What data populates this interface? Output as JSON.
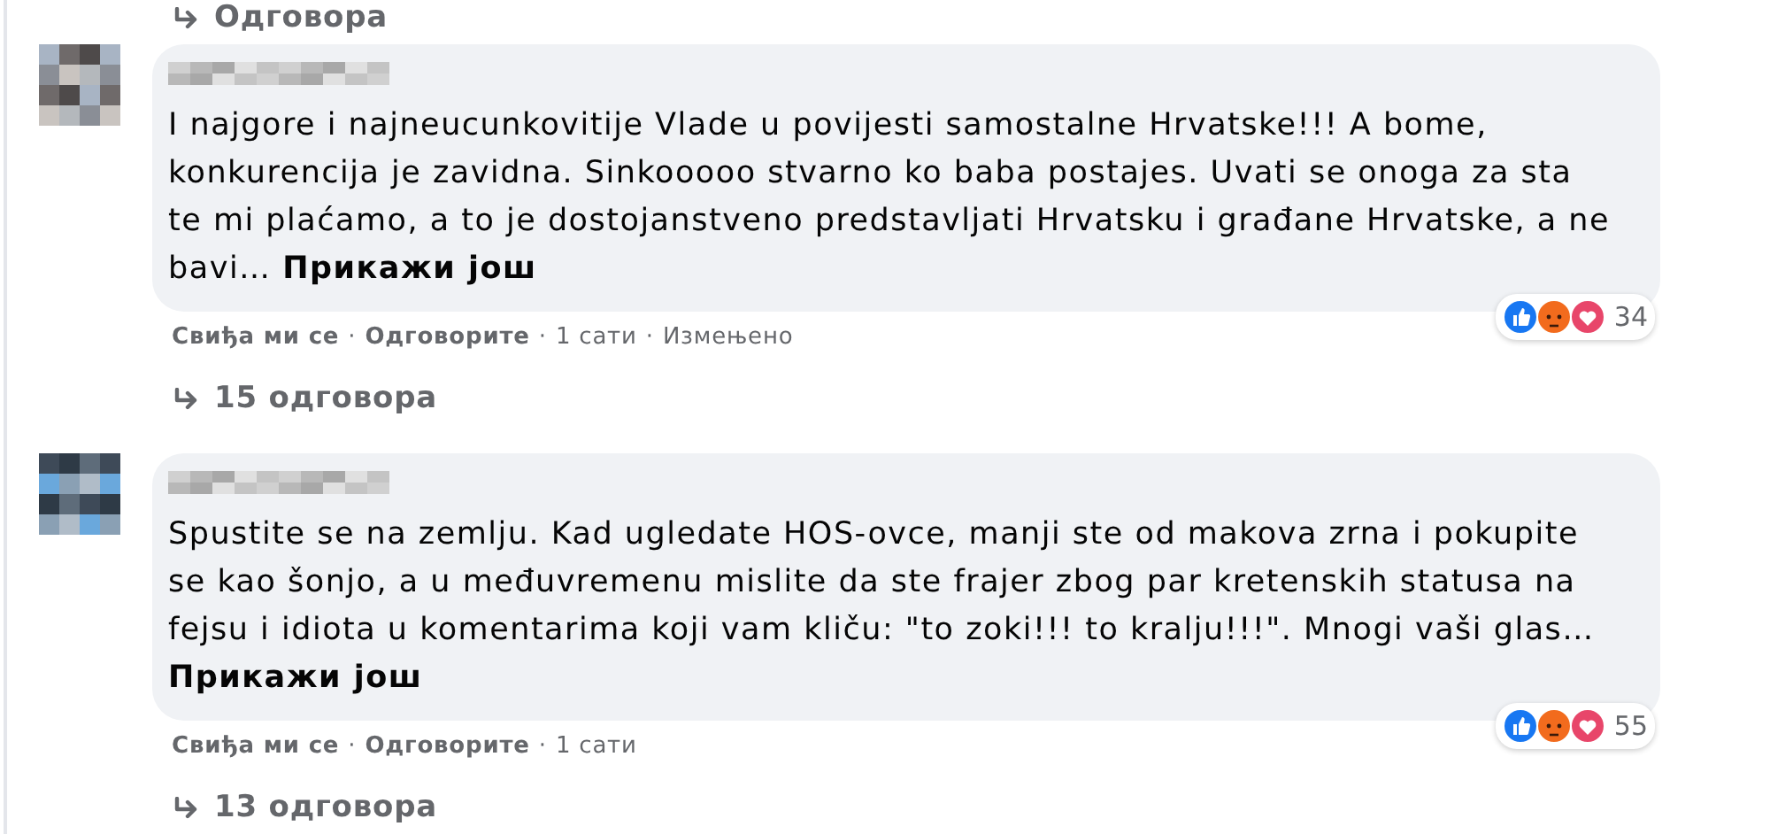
{
  "top_replies": {
    "label": "Одговора"
  },
  "comments": [
    {
      "text": "I najgore i najneucunkovitije Vlade u povijesti samostalne Hrvatske!!! A bome,\nkonkurencija je zavidna. Sinkooooo stvarno ko baba postajes. Uvati se onoga za sta\nte mi plaćamo, a to je dostojanstveno predstavljati Hrvatsku i građane Hrvatske, a ne\nbavi…",
      "see_more": "Прикажи још",
      "meta": [
        {
          "text": "Свиђа ми се",
          "kind": "link"
        },
        {
          "text": "·",
          "kind": "separator"
        },
        {
          "text": "Одговорите",
          "kind": "link"
        },
        {
          "text": "·",
          "kind": "separator"
        },
        {
          "text": "1 сати",
          "kind": "info"
        },
        {
          "text": "·",
          "kind": "separator"
        },
        {
          "text": "Измењено",
          "kind": "info"
        }
      ],
      "reactions": {
        "count": "34"
      },
      "replies": "15 одговора"
    },
    {
      "text": "Spustite se na zemlju. Kad ugledate HOS-ovce, manji ste od makova zrna i pokupite\nse kao šonjo, a u međuvremenu mislite da ste frajer zbog par kretenskih statusa na\nfejsu i idiota u komentarima koji vam kliču: \"to zoki!!! to kralju!!!\". Mnogi vaši glas…\n",
      "see_more": "Прикажи још",
      "meta": [
        {
          "text": "Свиђа ми се",
          "kind": "link"
        },
        {
          "text": "·",
          "kind": "separator"
        },
        {
          "text": "Одговорите",
          "kind": "link"
        },
        {
          "text": "·",
          "kind": "separator"
        },
        {
          "text": "1 сати",
          "kind": "info"
        }
      ],
      "reactions": {
        "count": "55"
      },
      "replies": "13 одговора"
    }
  ]
}
